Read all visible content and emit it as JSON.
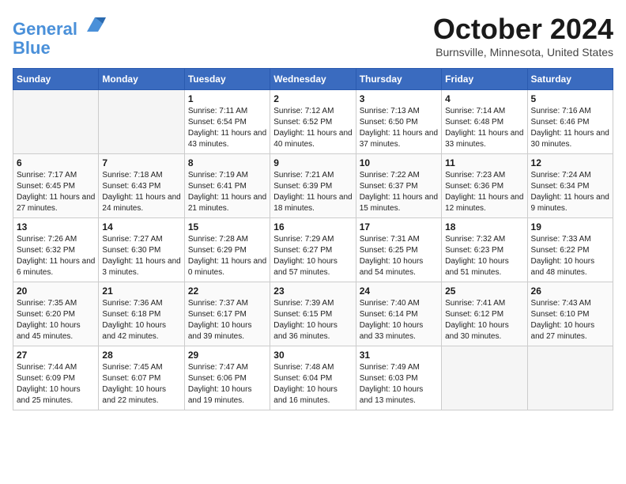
{
  "header": {
    "logo_line1": "General",
    "logo_line2": "Blue",
    "month": "October 2024",
    "location": "Burnsville, Minnesota, United States"
  },
  "days_of_week": [
    "Sunday",
    "Monday",
    "Tuesday",
    "Wednesday",
    "Thursday",
    "Friday",
    "Saturday"
  ],
  "weeks": [
    [
      {
        "num": "",
        "empty": true
      },
      {
        "num": "",
        "empty": true
      },
      {
        "num": "1",
        "sunrise": "Sunrise: 7:11 AM",
        "sunset": "Sunset: 6:54 PM",
        "daylight": "Daylight: 11 hours and 43 minutes."
      },
      {
        "num": "2",
        "sunrise": "Sunrise: 7:12 AM",
        "sunset": "Sunset: 6:52 PM",
        "daylight": "Daylight: 11 hours and 40 minutes."
      },
      {
        "num": "3",
        "sunrise": "Sunrise: 7:13 AM",
        "sunset": "Sunset: 6:50 PM",
        "daylight": "Daylight: 11 hours and 37 minutes."
      },
      {
        "num": "4",
        "sunrise": "Sunrise: 7:14 AM",
        "sunset": "Sunset: 6:48 PM",
        "daylight": "Daylight: 11 hours and 33 minutes."
      },
      {
        "num": "5",
        "sunrise": "Sunrise: 7:16 AM",
        "sunset": "Sunset: 6:46 PM",
        "daylight": "Daylight: 11 hours and 30 minutes."
      }
    ],
    [
      {
        "num": "6",
        "sunrise": "Sunrise: 7:17 AM",
        "sunset": "Sunset: 6:45 PM",
        "daylight": "Daylight: 11 hours and 27 minutes."
      },
      {
        "num": "7",
        "sunrise": "Sunrise: 7:18 AM",
        "sunset": "Sunset: 6:43 PM",
        "daylight": "Daylight: 11 hours and 24 minutes."
      },
      {
        "num": "8",
        "sunrise": "Sunrise: 7:19 AM",
        "sunset": "Sunset: 6:41 PM",
        "daylight": "Daylight: 11 hours and 21 minutes."
      },
      {
        "num": "9",
        "sunrise": "Sunrise: 7:21 AM",
        "sunset": "Sunset: 6:39 PM",
        "daylight": "Daylight: 11 hours and 18 minutes."
      },
      {
        "num": "10",
        "sunrise": "Sunrise: 7:22 AM",
        "sunset": "Sunset: 6:37 PM",
        "daylight": "Daylight: 11 hours and 15 minutes."
      },
      {
        "num": "11",
        "sunrise": "Sunrise: 7:23 AM",
        "sunset": "Sunset: 6:36 PM",
        "daylight": "Daylight: 11 hours and 12 minutes."
      },
      {
        "num": "12",
        "sunrise": "Sunrise: 7:24 AM",
        "sunset": "Sunset: 6:34 PM",
        "daylight": "Daylight: 11 hours and 9 minutes."
      }
    ],
    [
      {
        "num": "13",
        "sunrise": "Sunrise: 7:26 AM",
        "sunset": "Sunset: 6:32 PM",
        "daylight": "Daylight: 11 hours and 6 minutes."
      },
      {
        "num": "14",
        "sunrise": "Sunrise: 7:27 AM",
        "sunset": "Sunset: 6:30 PM",
        "daylight": "Daylight: 11 hours and 3 minutes."
      },
      {
        "num": "15",
        "sunrise": "Sunrise: 7:28 AM",
        "sunset": "Sunset: 6:29 PM",
        "daylight": "Daylight: 11 hours and 0 minutes."
      },
      {
        "num": "16",
        "sunrise": "Sunrise: 7:29 AM",
        "sunset": "Sunset: 6:27 PM",
        "daylight": "Daylight: 10 hours and 57 minutes."
      },
      {
        "num": "17",
        "sunrise": "Sunrise: 7:31 AM",
        "sunset": "Sunset: 6:25 PM",
        "daylight": "Daylight: 10 hours and 54 minutes."
      },
      {
        "num": "18",
        "sunrise": "Sunrise: 7:32 AM",
        "sunset": "Sunset: 6:23 PM",
        "daylight": "Daylight: 10 hours and 51 minutes."
      },
      {
        "num": "19",
        "sunrise": "Sunrise: 7:33 AM",
        "sunset": "Sunset: 6:22 PM",
        "daylight": "Daylight: 10 hours and 48 minutes."
      }
    ],
    [
      {
        "num": "20",
        "sunrise": "Sunrise: 7:35 AM",
        "sunset": "Sunset: 6:20 PM",
        "daylight": "Daylight: 10 hours and 45 minutes."
      },
      {
        "num": "21",
        "sunrise": "Sunrise: 7:36 AM",
        "sunset": "Sunset: 6:18 PM",
        "daylight": "Daylight: 10 hours and 42 minutes."
      },
      {
        "num": "22",
        "sunrise": "Sunrise: 7:37 AM",
        "sunset": "Sunset: 6:17 PM",
        "daylight": "Daylight: 10 hours and 39 minutes."
      },
      {
        "num": "23",
        "sunrise": "Sunrise: 7:39 AM",
        "sunset": "Sunset: 6:15 PM",
        "daylight": "Daylight: 10 hours and 36 minutes."
      },
      {
        "num": "24",
        "sunrise": "Sunrise: 7:40 AM",
        "sunset": "Sunset: 6:14 PM",
        "daylight": "Daylight: 10 hours and 33 minutes."
      },
      {
        "num": "25",
        "sunrise": "Sunrise: 7:41 AM",
        "sunset": "Sunset: 6:12 PM",
        "daylight": "Daylight: 10 hours and 30 minutes."
      },
      {
        "num": "26",
        "sunrise": "Sunrise: 7:43 AM",
        "sunset": "Sunset: 6:10 PM",
        "daylight": "Daylight: 10 hours and 27 minutes."
      }
    ],
    [
      {
        "num": "27",
        "sunrise": "Sunrise: 7:44 AM",
        "sunset": "Sunset: 6:09 PM",
        "daylight": "Daylight: 10 hours and 25 minutes."
      },
      {
        "num": "28",
        "sunrise": "Sunrise: 7:45 AM",
        "sunset": "Sunset: 6:07 PM",
        "daylight": "Daylight: 10 hours and 22 minutes."
      },
      {
        "num": "29",
        "sunrise": "Sunrise: 7:47 AM",
        "sunset": "Sunset: 6:06 PM",
        "daylight": "Daylight: 10 hours and 19 minutes."
      },
      {
        "num": "30",
        "sunrise": "Sunrise: 7:48 AM",
        "sunset": "Sunset: 6:04 PM",
        "daylight": "Daylight: 10 hours and 16 minutes."
      },
      {
        "num": "31",
        "sunrise": "Sunrise: 7:49 AM",
        "sunset": "Sunset: 6:03 PM",
        "daylight": "Daylight: 10 hours and 13 minutes."
      },
      {
        "num": "",
        "empty": true
      },
      {
        "num": "",
        "empty": true
      }
    ]
  ]
}
